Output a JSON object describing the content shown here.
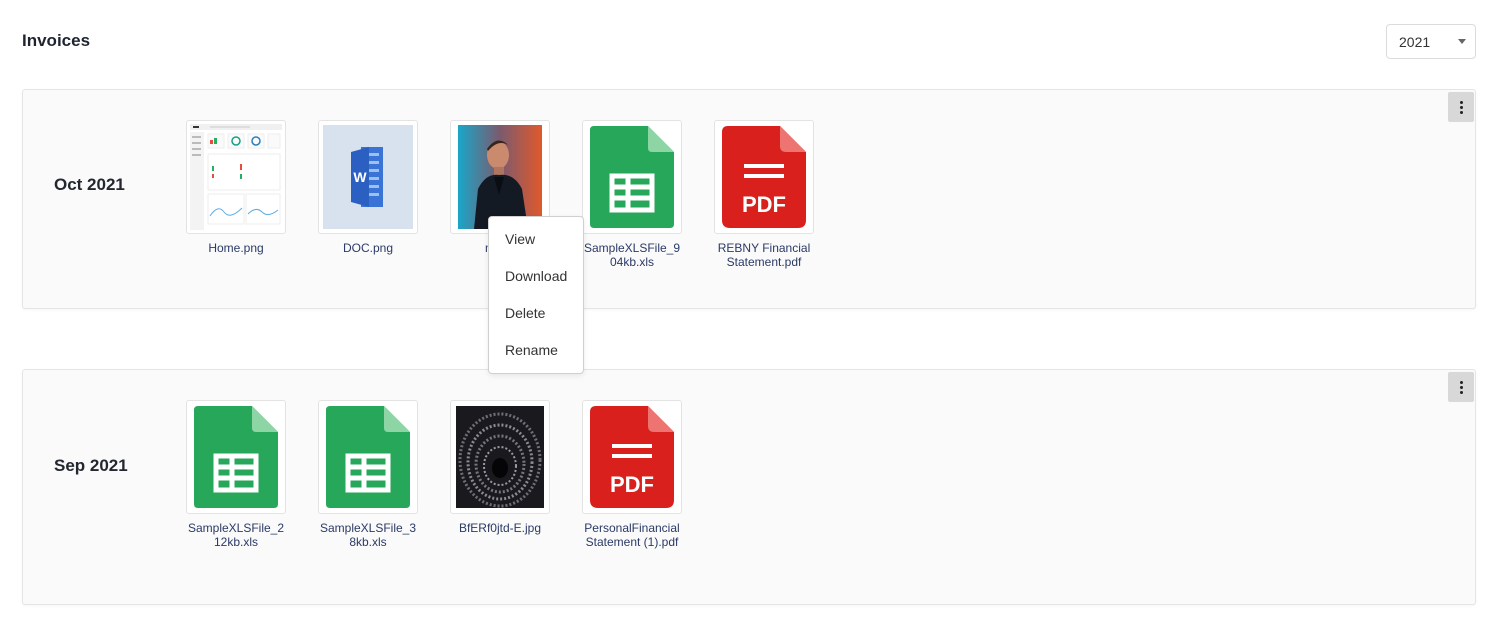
{
  "header": {
    "title": "Invoices"
  },
  "year_select": {
    "value": "2021"
  },
  "groups": [
    {
      "label": "Oct 2021",
      "files": [
        {
          "name": "Home.png",
          "icon": "screenshot-thumbnail"
        },
        {
          "name": "DOC.png",
          "icon": "word-doc-icon"
        },
        {
          "name": "man-i",
          "icon": "photo-thumbnail"
        },
        {
          "name": "SampleXLSFile_904kb.xls",
          "icon": "sheet-file-icon"
        },
        {
          "name": "REBNY Financial Statement.pdf",
          "icon": "pdf-file-icon"
        }
      ]
    },
    {
      "label": "Sep 2021",
      "files": [
        {
          "name": "SampleXLSFile_212kb.xls",
          "icon": "sheet-file-icon"
        },
        {
          "name": "SampleXLSFile_38kb.xls",
          "icon": "sheet-file-icon"
        },
        {
          "name": "BfERf0jtd-E.jpg",
          "icon": "photo-thumbnail"
        },
        {
          "name": "PersonalFinancialStatement (1).pdf",
          "icon": "pdf-file-icon"
        }
      ]
    }
  ],
  "context_menu": {
    "items": [
      "View",
      "Download",
      "Delete",
      "Rename"
    ]
  },
  "icons": {
    "kebab": "more-vertical-icon",
    "caret": "caret-down-icon"
  },
  "colors": {
    "sheet": "#27a75a",
    "pdf": "#d9201d",
    "word": "#2b5fc1"
  }
}
